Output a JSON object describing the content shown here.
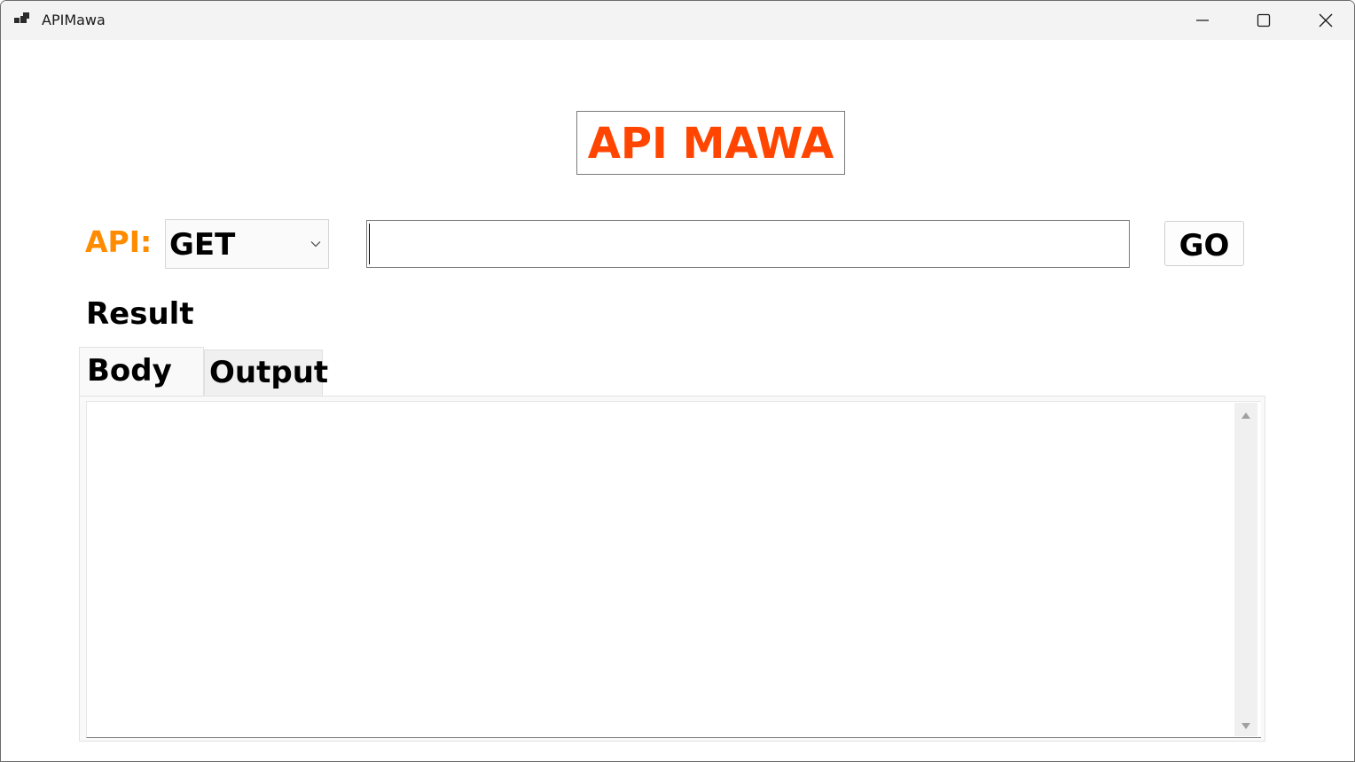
{
  "window": {
    "title": "APIMawa"
  },
  "icons": {
    "app": "app-icon",
    "minimize": "minimize-icon",
    "maximize": "maximize-icon",
    "close": "close-icon",
    "dropdown": "chevron-down-icon",
    "scroll_up": "scroll-up-arrow-icon",
    "scroll_down": "scroll-down-arrow-icon"
  },
  "colors": {
    "banner": "#ff4500",
    "api_label": "#ff8c00"
  },
  "header": {
    "banner": "API MAWA"
  },
  "request": {
    "api_label": "API:",
    "method": "GET",
    "url_value": "",
    "go_label": "GO"
  },
  "result": {
    "label": "Result",
    "tabs": [
      {
        "label": "Body",
        "selected": true
      },
      {
        "label": "Output",
        "selected": false
      }
    ],
    "body_text": ""
  }
}
